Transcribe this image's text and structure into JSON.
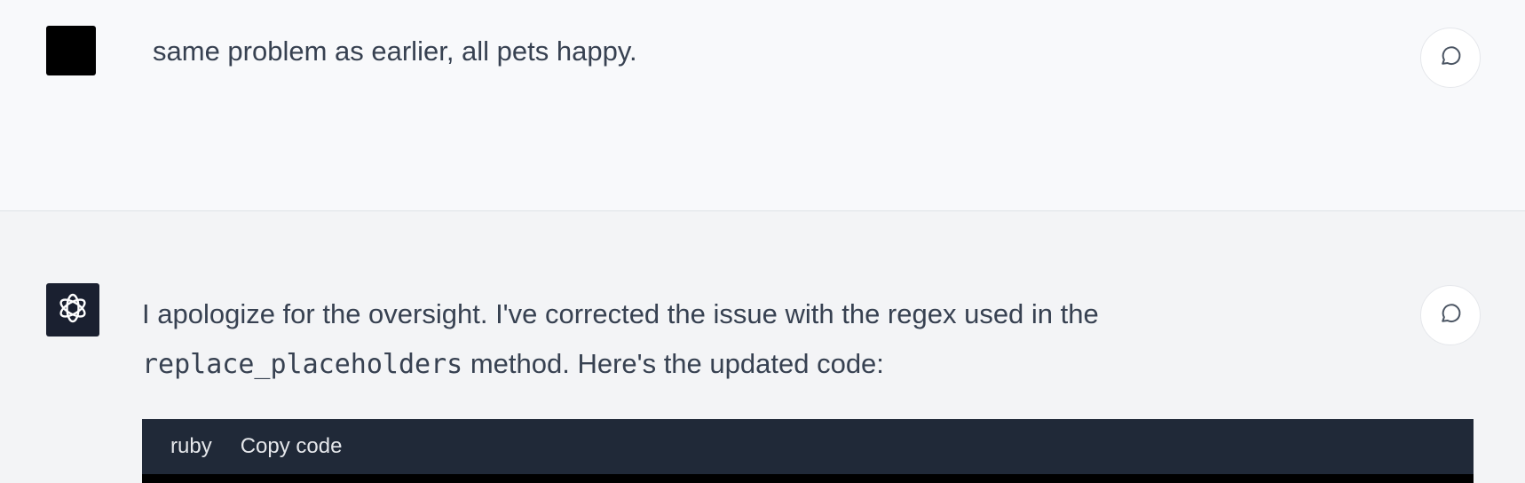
{
  "conversation": {
    "user_message": {
      "text": "same problem as earlier, all pets happy."
    },
    "assistant_message": {
      "line1": "I apologize for the oversight. I've corrected the issue with the regex used in the",
      "inline_code": "replace_placeholders",
      "line2_rest": " method. Here's the updated code:",
      "code_block": {
        "language": "ruby",
        "copy_label": "Copy code"
      }
    }
  },
  "colors": {
    "user_bg": "#f8f9fb",
    "assistant_bg": "#f3f4f6",
    "code_header_bg": "#202938",
    "text": "#374151"
  },
  "icons": [
    "chatgpt-logo-icon",
    "comment-icon"
  ]
}
